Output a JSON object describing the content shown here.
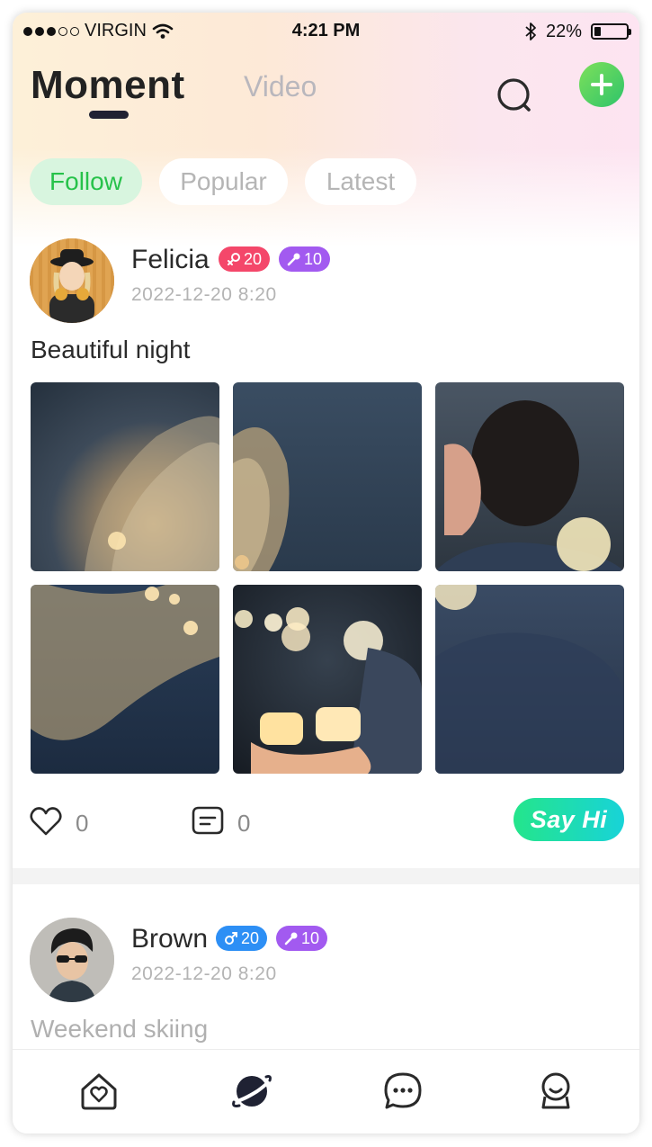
{
  "status_bar": {
    "carrier": "VIRGIN",
    "time": "4:21 PM",
    "battery_percent": "22%",
    "battery_level": 0.22,
    "signal_bars": 3,
    "signal_total": 5,
    "icons": [
      "wifi-icon",
      "bluetooth-icon",
      "battery-icon"
    ]
  },
  "nav": {
    "tabs": [
      {
        "label": "Moment",
        "active": true
      },
      {
        "label": "Video",
        "active": false
      }
    ],
    "search_icon": "search-icon",
    "add_icon": "plus-icon"
  },
  "filters": [
    {
      "label": "Follow",
      "active": true
    },
    {
      "label": "Popular",
      "active": false
    },
    {
      "label": "Latest",
      "active": false
    }
  ],
  "posts": [
    {
      "username": "Felicia",
      "gender": "female",
      "gender_badge": "20",
      "level_badge": "10",
      "time": "2022-12-20 8:20",
      "text": "Beautiful night",
      "photos": 6,
      "likes": "0",
      "comments": "0",
      "say_hi": "Say Hi"
    },
    {
      "username": "Brown",
      "gender": "male",
      "gender_badge": "20",
      "level_badge": "10",
      "time": "2022-12-20 8:20",
      "text": "Weekend skiing"
    }
  ],
  "tabbar": {
    "items": [
      {
        "icon": "home-heart-icon",
        "active": false
      },
      {
        "icon": "planet-icon",
        "active": true
      },
      {
        "icon": "chat-icon",
        "active": false
      },
      {
        "icon": "profile-icon",
        "active": false
      }
    ]
  },
  "colors": {
    "accent_green": "#27c24a",
    "say_hi_gradient": [
      "#24e58b",
      "#18d3d8"
    ],
    "female_badge": "#f4476a",
    "male_badge": "#2d8ff5",
    "level_badge": "#a25af0"
  }
}
